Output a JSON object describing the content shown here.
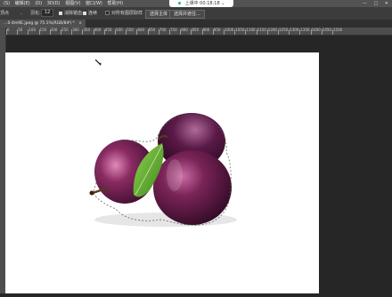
{
  "menubar": {
    "items": [
      "(S)",
      "编辑(E)",
      "(D)",
      "3D(D)",
      "视图(V)",
      "窗口(W)",
      "帮助(H)"
    ]
  },
  "timer": {
    "label": "上课中 00:18:18",
    "arrow": "⌄"
  },
  "window_controls": [
    "—",
    "□",
    "✕"
  ],
  "options": {
    "mode": "顶点",
    "feather_label": "羽化:",
    "feather_value": "12",
    "antialias": "消除锯齿",
    "contiguous": "连续",
    "sample_all": "对所有图层取样",
    "select_subject": "选择主体",
    "select_mask": "选择并遮住..."
  },
  "tab": {
    "label": "…0-4m9E.jpeg @ 75.1%(RGB/8#) *",
    "close": "×"
  },
  "ruler": {
    "ticks": [
      "0",
      "50",
      "100",
      "150",
      "200",
      "250",
      "300",
      "350",
      "400",
      "450",
      "500",
      "550",
      "600",
      "650",
      "700",
      "750",
      "800",
      "850",
      "900",
      "950",
      "1000",
      "1050",
      "1100",
      "1150",
      "1200",
      "1250",
      "1300",
      "1350",
      "1400",
      "1450",
      "1500"
    ]
  },
  "colors": {
    "workspace": "#262626",
    "plum_dark": "#3a0f2e",
    "plum_mid": "#7a2458",
    "leaf": "#6ab23a",
    "timer_dot": "#1fb57a"
  },
  "icons": {
    "cursor": "magic-wand-cursor-icon"
  }
}
